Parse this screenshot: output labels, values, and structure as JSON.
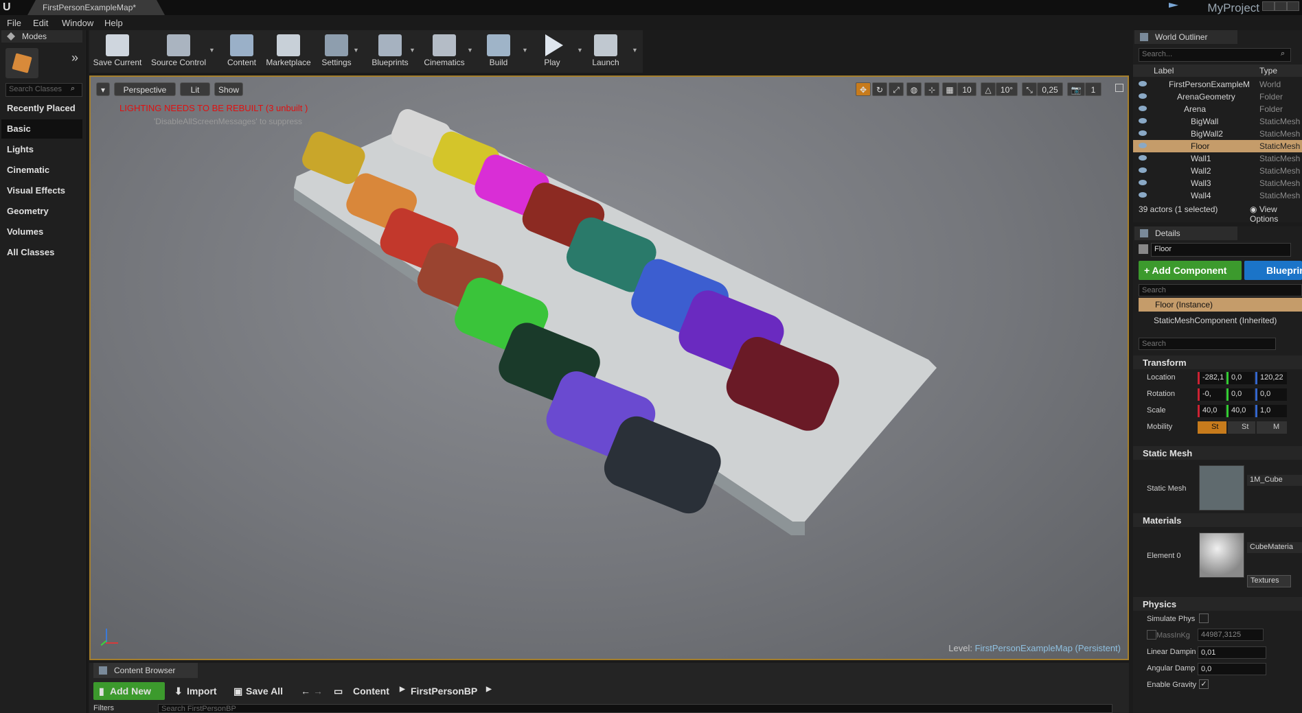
{
  "titlebar": {
    "tab_title": "FirstPersonExampleMap*",
    "project": "MyProject"
  },
  "menubar": {
    "items": [
      "File",
      "Edit",
      "Window",
      "Help"
    ]
  },
  "modes": {
    "tab": "Modes",
    "search_placeholder": "Search Classes",
    "categories": [
      "Recently Placed",
      "Basic",
      "Lights",
      "Cinematic",
      "Visual Effects",
      "Geometry",
      "Volumes",
      "All Classes"
    ],
    "active": "Basic"
  },
  "toolbar": {
    "buttons": [
      "Save Current",
      "Source Control",
      "Content",
      "Marketplace",
      "Settings",
      "Blueprints",
      "Cinematics",
      "Build",
      "Play",
      "Launch"
    ]
  },
  "viewport": {
    "perspective": "Perspective",
    "lit": "Lit",
    "show": "Show",
    "snap_values": [
      "10",
      "10°",
      "0,25",
      "1"
    ],
    "warning": "LIGHTING NEEDS TO BE REBUILT (3 unbuilt )",
    "suppress_hint": "'DisableAllScreenMessages' to suppress",
    "level_label": "Level:",
    "level_name": "FirstPersonExampleMap (Persistent)"
  },
  "outliner": {
    "tab": "World Outliner",
    "search_placeholder": "Search...",
    "col_label": "Label",
    "col_type": "Type",
    "rows": [
      {
        "label": "FirstPersonExampleM",
        "type": "World"
      },
      {
        "label": "ArenaGeometry",
        "type": "Folder"
      },
      {
        "label": "Arena",
        "type": "Folder"
      },
      {
        "label": "BigWall",
        "type": "StaticMesh"
      },
      {
        "label": "BigWall2",
        "type": "StaticMesh"
      },
      {
        "label": "Floor",
        "type": "StaticMesh"
      },
      {
        "label": "Wall1",
        "type": "StaticMesh"
      },
      {
        "label": "Wall2",
        "type": "StaticMesh"
      },
      {
        "label": "Wall3",
        "type": "StaticMesh"
      },
      {
        "label": "Wall4",
        "type": "StaticMesh"
      }
    ],
    "selected": "Floor",
    "footer": "39 actors (1 selected)",
    "view_options": "View Options"
  },
  "details": {
    "tab": "Details",
    "name_value": "Floor",
    "add_component": "+ Add Component",
    "blueprint": "Blueprint",
    "search_placeholder": "Search",
    "instance": "Floor (Instance)",
    "component": "StaticMeshComponent (Inherited)",
    "search2_placeholder": "Search",
    "transform": {
      "title": "Transform",
      "location_label": "Location",
      "location": [
        "-282,1",
        "0,0",
        "120,22"
      ],
      "rotation_label": "Rotation",
      "rotation": [
        "-0,",
        "0,0",
        "0,0"
      ],
      "scale_label": "Scale",
      "scale": [
        "40,0",
        "40,0",
        "1,0"
      ],
      "mobility_label": "Mobility",
      "mobility": [
        "St",
        "St",
        "M"
      ]
    },
    "static_mesh": {
      "title": "Static Mesh",
      "label": "Static Mesh",
      "value": "1M_Cube"
    },
    "materials": {
      "title": "Materials",
      "label": "Element 0",
      "value": "CubeMateria",
      "textures": "Textures"
    },
    "physics": {
      "title": "Physics",
      "simulate": "Simulate Phys",
      "mass_label": "MassInKg",
      "mass_value": "44987,3125",
      "linear_label": "Linear Dampin",
      "linear_value": "0,01",
      "angular_label": "Angular Damp",
      "angular_value": "0,0",
      "gravity_label": "Enable Gravity"
    }
  },
  "content_browser": {
    "tab": "Content Browser",
    "add_new": "Add New",
    "import": "Import",
    "save_all": "Save All",
    "path": [
      "Content",
      "FirstPersonBP"
    ],
    "filters": "Filters",
    "search_placeholder": "Search FirstPersonBP"
  },
  "palette_colors": [
    "#d6d6d6",
    "#c9a62a",
    "#d4c52a",
    "#d9873a",
    "#d92ed6",
    "#c2382c",
    "#8c2a22",
    "#9a4430",
    "#2a7a6a",
    "#3ac43a",
    "#3c5ed0",
    "#1a3a2a",
    "#6a2ac0",
    "#6a4ad0",
    "#6a1a26",
    "#2a3038"
  ]
}
